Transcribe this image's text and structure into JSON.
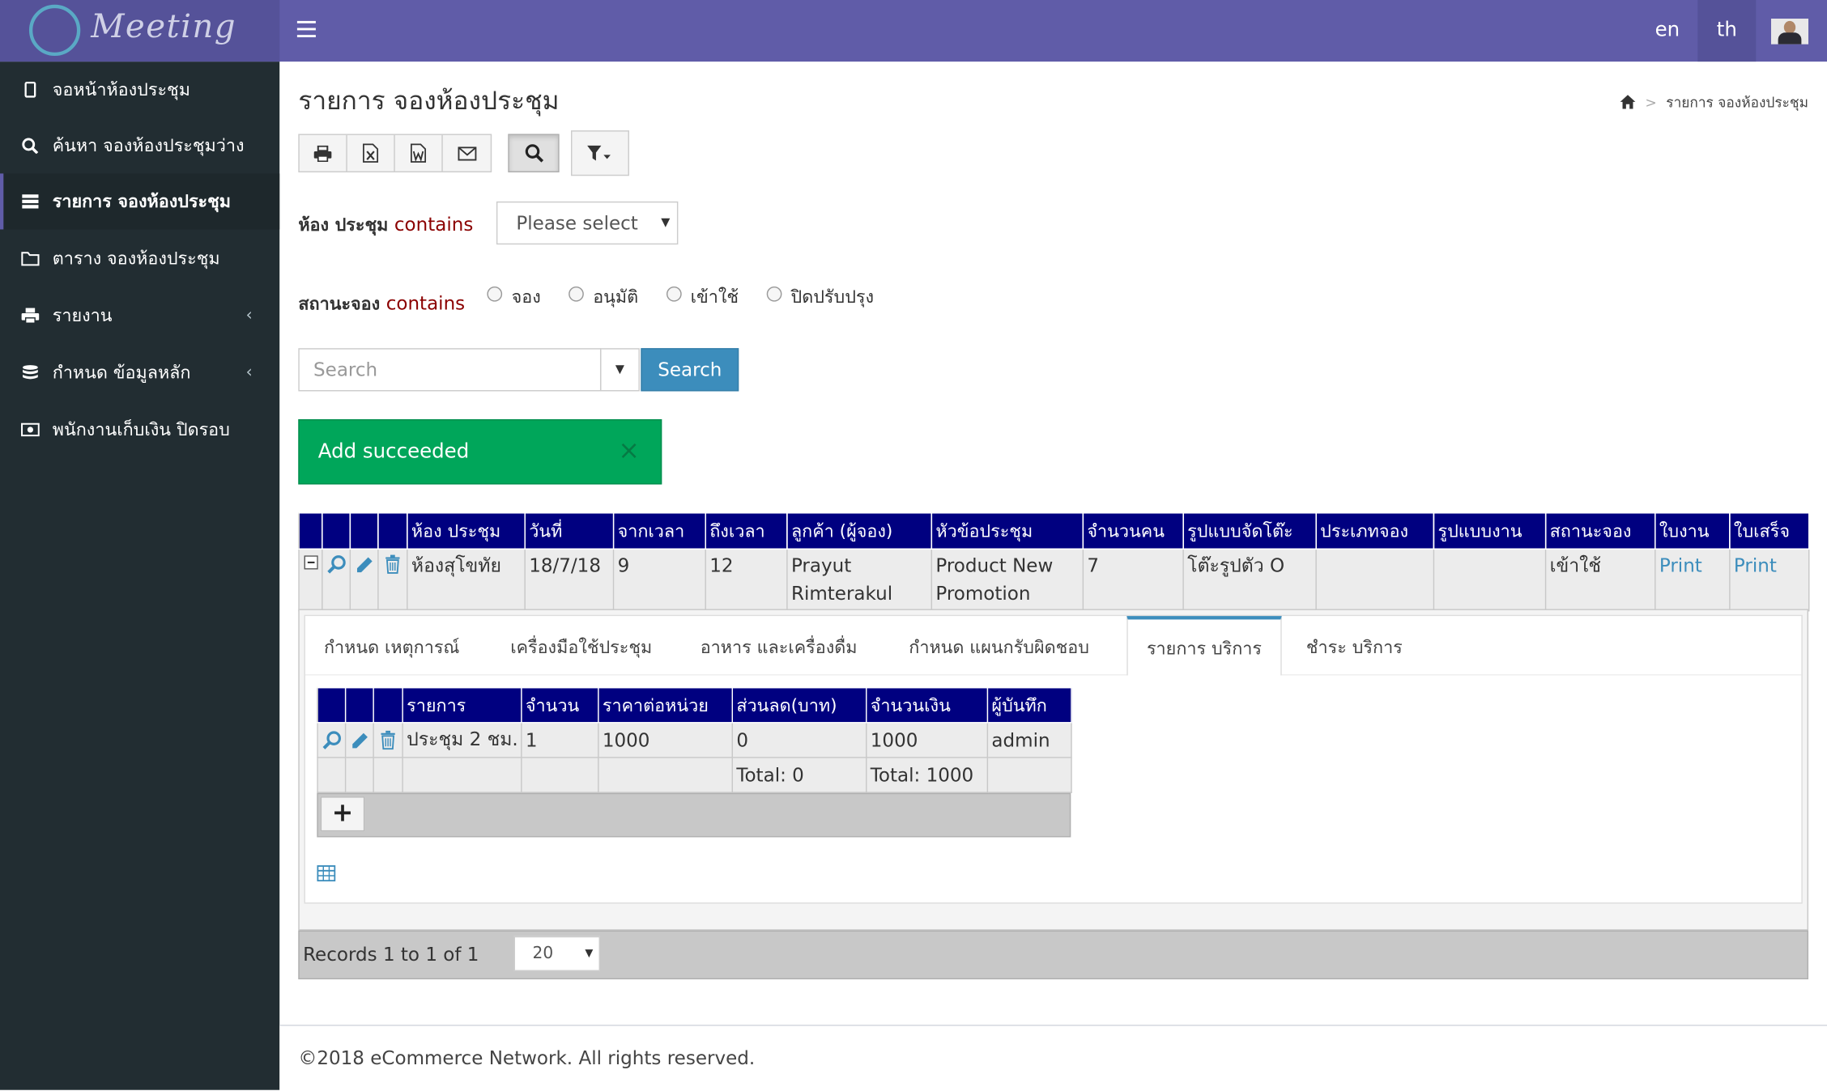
{
  "header": {
    "logo_text": "Meeting",
    "lang_en": "en",
    "lang_th": "th",
    "accent": "#605ca8"
  },
  "sidebar": {
    "items": [
      {
        "label": "จอหน้าห้องประชุม",
        "icon": "tablet-icon"
      },
      {
        "label": "ค้นหา จองห้องประชุมว่าง",
        "icon": "search-icon"
      },
      {
        "label": "รายการ จองห้องประชุม",
        "icon": "list-icon",
        "active": true
      },
      {
        "label": "ตาราง จองห้องประชุม",
        "icon": "folder-icon"
      },
      {
        "label": "รายงาน",
        "icon": "print-icon",
        "chevron": "‹"
      },
      {
        "label": "กำหนด ข้อมูลหลัก",
        "icon": "database-icon",
        "chevron": "‹"
      },
      {
        "label": "พนักงานเก็บเงิน ปิดรอบ",
        "icon": "money-icon"
      }
    ]
  },
  "page": {
    "title": "รายการ จองห้องประชุม",
    "breadcrumb": "รายการ จองห้องประชุม",
    "breadcrumb_sep": ">"
  },
  "filters": {
    "room_label": "ห้อง ประชุม",
    "contains": "contains",
    "room_select": "Please select",
    "status_label": "สถานะจอง",
    "status_options": [
      "จอง",
      "อนุมัติ",
      "เข้าใช้",
      "ปิดปรับปรุง"
    ]
  },
  "search": {
    "placeholder": "Search",
    "button": "Search"
  },
  "alert": {
    "message": "Add succeeded",
    "close": "×"
  },
  "grid": {
    "columns": [
      "ห้อง ประชุม",
      "วันที่",
      "จากเวลา",
      "ถึงเวลา",
      "ลูกค้า (ผู้จอง)",
      "หัวข้อประชุม",
      "จำนวนคน",
      "รูปแบบจัดโต๊ะ",
      "ประเภทจอง",
      "รูปแบบงาน",
      "สถานะจอง",
      "ใบงาน",
      "ใบเสร็จ"
    ],
    "rows": [
      {
        "room": "ห้องสุโขทัย",
        "date": "18/7/18",
        "from": "9",
        "to": "12",
        "customer": "Prayut Rimterakul",
        "topic": "Product New Promotion",
        "people": "7",
        "table_style": "โต๊ะรูปตัว O",
        "booking_type": "",
        "event_type": "",
        "status": "เข้าใช้",
        "worksheet": "Print",
        "receipt": "Print"
      }
    ]
  },
  "detail_tabs": [
    {
      "label": "กำหนด เหตุการณ์"
    },
    {
      "label": "เครื่องมือใช้ประชุม"
    },
    {
      "label": "อาหาร และเครื่องดื่ม"
    },
    {
      "label": "กำหนด แผนกรับผิดชอบ"
    },
    {
      "label": "รายการ บริการ",
      "active": true
    },
    {
      "label": "ชำระ บริการ"
    }
  ],
  "services": {
    "columns": [
      "รายการ",
      "จำนวน",
      "ราคาต่อหน่วย",
      "ส่วนลด(บาท)",
      "จำนวนเงิน",
      "ผู้บันทึก"
    ],
    "rows": [
      {
        "item": "ประชุม 2 ชม.",
        "qty": "1",
        "unit_price": "1000",
        "discount": "0",
        "amount": "1000",
        "recorder": "admin"
      }
    ],
    "total_discount": "Total: 0",
    "total_amount": "Total: 1000",
    "add": "+"
  },
  "pager": {
    "records": "Records 1 to 1 of 1",
    "page_size": "20"
  },
  "footer": {
    "text": "©2018 eCommerce Network. All rights reserved."
  }
}
